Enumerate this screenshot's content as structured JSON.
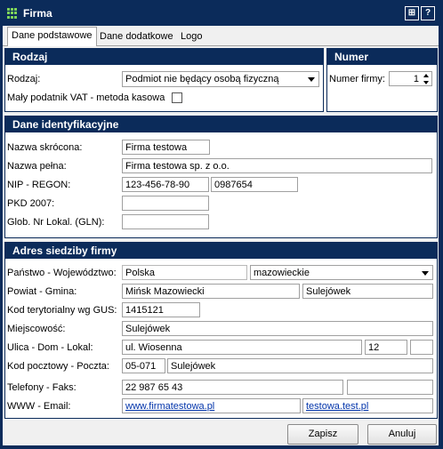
{
  "window": {
    "title": "Firma",
    "icon": "grid-app-icon",
    "help_label": "?",
    "calc_label": "⊞"
  },
  "tabs": [
    "Dane podstawowe",
    "Dane dodatkowe",
    "Logo"
  ],
  "rodzaj": {
    "header": "Rodzaj",
    "rodzaj_label": "Rodzaj:",
    "rodzaj_value": "Podmiot nie będący osobą fizyczną",
    "vat_label": "Mały podatnik VAT - metoda kasowa"
  },
  "numer": {
    "header": "Numer",
    "label": "Numer firmy:",
    "value": "1"
  },
  "ident": {
    "header": "Dane identyfikacyjne",
    "short_label": "Nazwa skrócona:",
    "short_value": "Firma testowa",
    "full_label": "Nazwa pełna:",
    "full_value": "Firma testowa sp. z o.o.",
    "nip_label": "NIP - REGON:",
    "nip_value": "123-456-78-90",
    "regon_value": "0987654",
    "pkd_label": "PKD 2007:",
    "pkd_value": "",
    "gln_label": "Glob. Nr Lokal. (GLN):",
    "gln_value": ""
  },
  "adres": {
    "header": "Adres siedziby firmy",
    "country_label": "Państwo - Województwo:",
    "country_value": "Polska",
    "voiv_value": "mazowieckie",
    "powiat_label": "Powiat - Gmina:",
    "powiat_value": "Mińsk Mazowiecki",
    "gmina_value": "Sulejówek",
    "gus_label": "Kod terytorialny wg GUS:",
    "gus_value": "1415121",
    "city_label": "Miejscowość:",
    "city_value": "Sulejówek",
    "street_label": "Ulica - Dom - Lokal:",
    "street_value": "ul. Wiosenna",
    "house_value": "12",
    "flat_value": "",
    "postal_label": "Kod pocztowy - Poczta:",
    "postal_value": "05-071",
    "post_value": "Sulejówek",
    "phone_label": "Telefony - Faks:",
    "phone_value": "22 987 65 43",
    "fax_value": "",
    "www_label": "WWW - Email:",
    "www_value": "www.firmatestowa.pl",
    "email_value": "testowa.test.pl"
  },
  "buttons": {
    "save": "Zapisz",
    "cancel": "Anuluj"
  }
}
